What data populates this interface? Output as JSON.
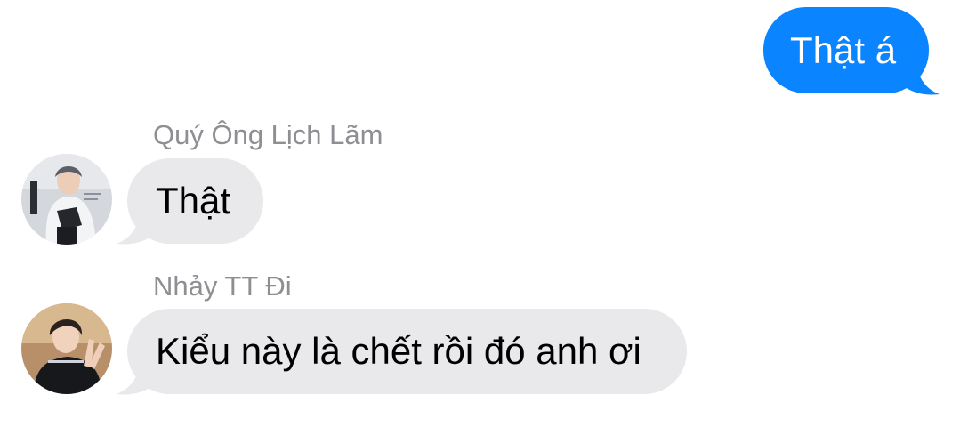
{
  "messages": [
    {
      "direction": "outgoing",
      "text": "Thật á"
    },
    {
      "direction": "incoming",
      "sender": "Quý Ông Lịch Lãm",
      "text": "Thật"
    },
    {
      "direction": "incoming",
      "sender": "Nhảy TT Đi",
      "text": "Kiểu này là chết rồi đó anh ơi"
    }
  ],
  "colors": {
    "outgoing_bubble": "#0a84ff",
    "incoming_bubble": "#e9e9eb",
    "sender_name": "#8e8e93"
  }
}
